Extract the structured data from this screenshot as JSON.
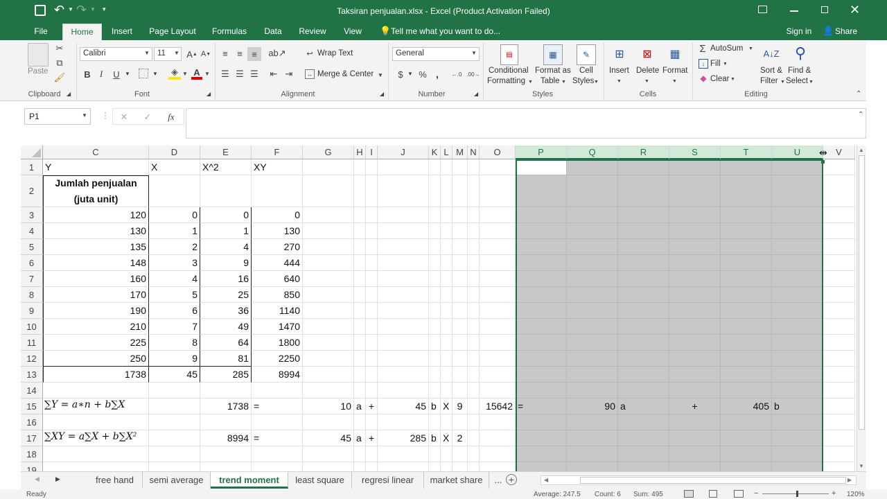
{
  "app": {
    "title": "Taksiran penjualan.xlsx - Excel (Product Activation Failed)"
  },
  "tabs": [
    "File",
    "Home",
    "Insert",
    "Page Layout",
    "Formulas",
    "Data",
    "Review",
    "View"
  ],
  "tell_me": "Tell me what you want to do...",
  "sign_in": "Sign in",
  "share": "Share",
  "ribbon": {
    "paste": "Paste",
    "clipboard": "Clipboard",
    "font_name": "Calibri",
    "font_size": "11",
    "font": "Font",
    "bold": "B",
    "italic": "I",
    "underline": "U",
    "wrap_text": "Wrap Text",
    "merge_center": "Merge & Center",
    "alignment": "Alignment",
    "number_format": "General",
    "number": "Number",
    "currency": "$",
    "percent": "%",
    "comma": ",",
    "cond_fmt_1": "Conditional",
    "cond_fmt_2": "Formatting",
    "fmt_table_1": "Format as",
    "fmt_table_2": "Table",
    "cell_styles_1": "Cell",
    "cell_styles_2": "Styles",
    "styles": "Styles",
    "insert": "Insert",
    "delete": "Delete",
    "format": "Format",
    "cells": "Cells",
    "autosum": "AutoSum",
    "fill": "Fill",
    "clear": "Clear",
    "sort_1": "Sort &",
    "sort_2": "Filter",
    "find_1": "Find &",
    "find_2": "Select",
    "editing": "Editing"
  },
  "name_box": "P1",
  "fx": "fx",
  "columns": [
    "C",
    "D",
    "E",
    "F",
    "G",
    "H",
    "I",
    "J",
    "K",
    "L",
    "M",
    "N",
    "O",
    "P",
    "Q",
    "R",
    "S",
    "T",
    "U",
    "V"
  ],
  "rows": [
    "1",
    "2",
    "3",
    "4",
    "5",
    "6",
    "7",
    "8",
    "9",
    "10",
    "11",
    "12",
    "13",
    "14",
    "15",
    "16",
    "17",
    "18",
    "19"
  ],
  "cells": {
    "C1": "Y",
    "D1": "X",
    "E1": "X^2",
    "F1": "XY",
    "C2": "Jumlah penjualan\n(juta unit)",
    "C3": "120",
    "D3": "0",
    "E3": "0",
    "F3": "0",
    "C4": "130",
    "D4": "1",
    "E4": "1",
    "F4": "130",
    "C5": "135",
    "D5": "2",
    "E5": "4",
    "F5": "270",
    "C6": "148",
    "D6": "3",
    "E6": "9",
    "F6": "444",
    "C7": "160",
    "D7": "4",
    "E7": "16",
    "F7": "640",
    "C8": "170",
    "D8": "5",
    "E8": "25",
    "F8": "850",
    "C9": "190",
    "D9": "6",
    "E9": "36",
    "F9": "1140",
    "C10": "210",
    "D10": "7",
    "E10": "49",
    "F10": "1470",
    "C11": "225",
    "D11": "8",
    "E11": "64",
    "F11": "1800",
    "C12": "250",
    "D12": "9",
    "E12": "81",
    "F12": "2250",
    "C13": "1738",
    "D13": "45",
    "E13": "285",
    "F13": "8994",
    "E15": "1738",
    "F15": "=",
    "G15": "10",
    "H15": "a",
    "I15": "+",
    "J15": "45",
    "K15": "b",
    "L15": "X",
    "M15": "9",
    "O15": "15642",
    "P15": "=",
    "Q15": "90",
    "R15": "a",
    "S15": "+",
    "T15": "405",
    "U15": "b",
    "E17": "8994",
    "F17": "=",
    "G17": "45",
    "H17": "a",
    "I17": "+",
    "J17": "285",
    "K17": "b",
    "L17": "X",
    "M17": "2"
  },
  "formula15": "∑Y = a∗n + b∑X",
  "formula17": "∑XY = a∑X + b∑X²",
  "sheets": [
    "free hand",
    "semi average",
    "trend moment",
    "least square",
    "regresi linear",
    "market share",
    "..."
  ],
  "active_sheet": "trend moment",
  "status": {
    "ready": "Ready",
    "average": "Average: 247.5",
    "count": "Count: 6",
    "sum": "Sum: 495",
    "zoom": "120%"
  },
  "colors": {
    "excel_green": "#217346",
    "selection_gray": "#c8c8c8"
  }
}
